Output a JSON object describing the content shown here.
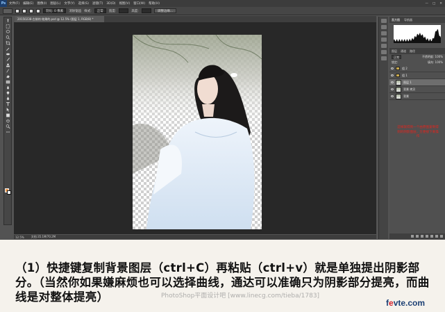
{
  "menubar": {
    "logo": "Ps",
    "items": [
      "文件(F)",
      "编辑(E)",
      "图像(I)",
      "图层(L)",
      "文字(Y)",
      "选择(S)",
      "滤镜(T)",
      "3D(D)",
      "视图(V)",
      "窗口(W)",
      "帮助(H)"
    ],
    "controls": [
      "—",
      "□",
      "✕"
    ]
  },
  "optionsbar": {
    "feather": "羽化: 0 像素",
    "antialias": "消除锯齿",
    "style_label": "样式:",
    "style_value": "正常",
    "width_label": "宽度:",
    "height_label": "高度:",
    "refine_button": "调整边缘..."
  },
  "document": {
    "tab_title": "20150238-古装的-效果的.psd @ 12.5% (图层 1, RGB/8) *"
  },
  "statusbar": {
    "zoom": "12.5%",
    "doc_info": "文档:35.1M/70.2M"
  },
  "panels": {
    "top_tabs": [
      "直方图",
      "导航器"
    ],
    "layer_tabs": [
      "图层",
      "通道",
      "路径"
    ],
    "blend_mode": "正常",
    "opacity": "不透明度: 100%",
    "lock": "锁定:",
    "fill": "填充: 100%",
    "layers": [
      {
        "name": "组 2",
        "kind": "folder",
        "selected": false
      },
      {
        "name": "组 1",
        "kind": "folder",
        "selected": false
      },
      {
        "name": "图层 1",
        "kind": "photo",
        "selected": true
      },
      {
        "name": "背景 拷贝",
        "kind": "photo",
        "selected": false
      },
      {
        "name": "背景",
        "kind": "photo",
        "selected": false
      }
    ]
  },
  "annotation": "这样就得到一个由原图复制得到的阴影图层，方便接下来操作",
  "caption": {
    "text": "（1）快捷键复制背景图层（ctrl+C）再粘贴（ctrl+v）就是单独提出阴影部分。（当然你如果嫌麻烦也可以选择曲线，通达可以准确只为阴影部分提亮，而曲线是对整体提亮）",
    "watermark": "PhotoShop平面设计吧 [www.linecg.com/tieba/1783]",
    "logo_main": "f",
    "logo_e": "e",
    "logo_rest": "vte.com"
  },
  "colors": {
    "foreground": "#f29b4f",
    "background": "#ffffff",
    "annotation": "#e8231c"
  }
}
